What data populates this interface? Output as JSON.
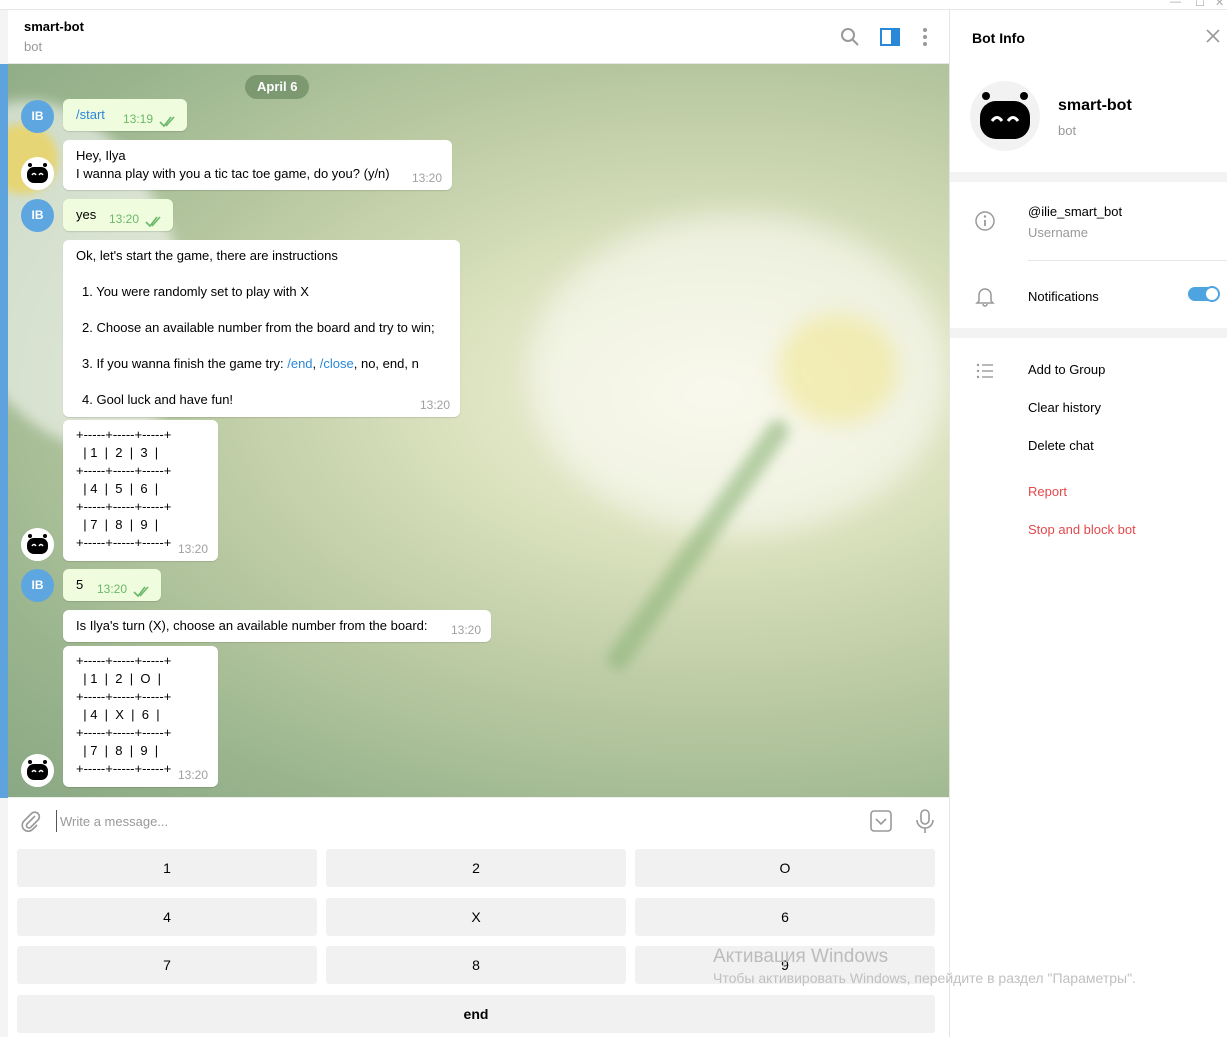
{
  "header": {
    "title": "smart-bot",
    "subtitle": "bot",
    "icons": [
      "search-icon",
      "sidebar-panel-icon",
      "more-vertical-icon"
    ]
  },
  "chat": {
    "date": "April 6",
    "user_initials": "IB",
    "messages": [
      {
        "from": "user",
        "text": "/start",
        "time": "13:19"
      },
      {
        "from": "bot",
        "lines": [
          "Hey, Ilya",
          "I wanna play with you a tic tac toe game, do you? (y/n)"
        ],
        "time": "13:20"
      },
      {
        "from": "user",
        "text": "yes",
        "time": "13:20"
      },
      {
        "from": "bot",
        "intro": "Ok, let's start the game, there are instructions",
        "step1": "1. You were randomly set to play with X",
        "step2": "2. Choose an available number from the board and try to win;",
        "step3_prefix": "3. If you wanna finish the game try: ",
        "step3_link1": "/end",
        "step3_sep": ", ",
        "step3_link2": "/close",
        "step3_suffix": ", no, end, n",
        "step4": "4. Gool luck and have fun!",
        "time": "13:20"
      },
      {
        "from": "bot",
        "board": "+-----+-----+-----+\n  | 1  |  2  |  3  |\n+-----+-----+-----+\n  | 4  |  5  |  6  |\n+-----+-----+-----+\n  | 7  |  8  |  9  |\n+-----+-----+-----+",
        "time": "13:20"
      },
      {
        "from": "user",
        "text": "5",
        "time": "13:20"
      },
      {
        "from": "bot",
        "text": "Is Ilya's turn (X), choose an available number from the board:",
        "time": "13:20"
      },
      {
        "from": "bot",
        "board": "+-----+-----+-----+\n  | 1  |  2  |  O  |\n+-----+-----+-----+\n  | 4  |  X  |  6  |\n+-----+-----+-----+\n  | 7  |  8  |  9  |\n+-----+-----+-----+",
        "time": "13:20"
      }
    ]
  },
  "composer": {
    "placeholder": "Write a message..."
  },
  "keyboard": {
    "rows": [
      [
        "1",
        "2",
        "O"
      ],
      [
        "4",
        "X",
        "6"
      ],
      [
        "7",
        "8",
        "9"
      ]
    ],
    "end": "end"
  },
  "info_panel": {
    "title": "Bot Info",
    "name": "smart-bot",
    "sub": "bot",
    "username": "@ilie_smart_bot",
    "username_label": "Username",
    "notifications": "Notifications",
    "notifications_on": true,
    "actions": [
      "Add to Group",
      "Clear history",
      "Delete chat"
    ],
    "danger": [
      "Report",
      "Stop and block bot"
    ]
  },
  "watermark": {
    "line1": "Активация Windows",
    "line2": "Чтобы активировать Windows, перейдите в раздел \"Параметры\"."
  },
  "colors": {
    "accent": "#4ea4e0",
    "outgoing_bubble": "#effdde",
    "danger": "#e3494c",
    "avatar": "#5ea6e0"
  }
}
